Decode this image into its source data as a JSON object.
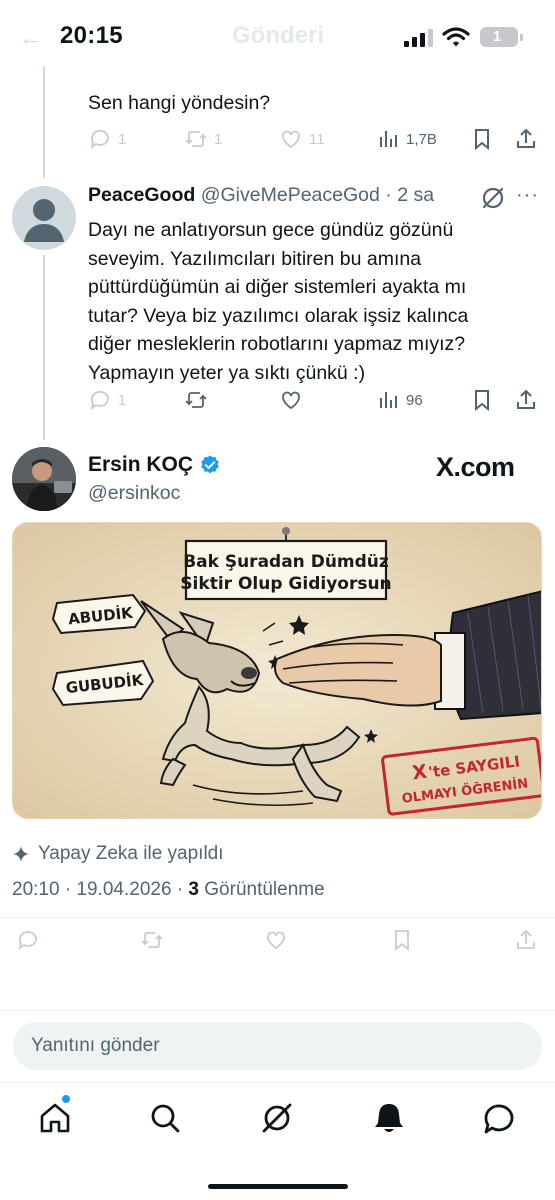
{
  "status_bar": {
    "time": "20:15",
    "back_faded": "←",
    "title_faded": "Gönderi",
    "battery": "1"
  },
  "parent_tweet": {
    "text": "Sen hangi yöndesin?",
    "stats": {
      "replies": "1",
      "retweets": "1",
      "likes": "11",
      "views": "1,7B"
    }
  },
  "reply_tweet": {
    "name": "PeaceGood",
    "handle": "@GiveMePeaceGod",
    "time": "· 2 sa",
    "text_lines": [
      "Dayı ne anlatıyorsun gece gündüz gözünü",
      "seveyim. Yazılımcıları bitiren bu amına",
      "püttürdüğümün ai diğer sistemleri ayakta mı",
      "tutar? Veya biz yazılımcı olarak işsiz kalınca",
      "diğer mesleklerin robotlarını yapmaz mıyız?",
      "Yapmayın yeter ya sıktı çünkü :)"
    ],
    "stats": {
      "replies": "1",
      "views": "96"
    },
    "more": "···"
  },
  "main_tweet": {
    "name": "Ersin KOÇ",
    "handle": "@ersinkoc",
    "brand_logo": "X.com",
    "image": {
      "sign_line1": "Bak Şuradan Dümdüz",
      "sign_line2": "Siktir Olup Gidiyorsun",
      "bubble_left1": "ABUDİK",
      "bubble_left2": "GUBUDİK",
      "stamp_line1_x": "X",
      "stamp_line1_rest": "'te SAYGILI",
      "stamp_line2": "OLMAYI ÖĞRENİN"
    },
    "ai_label": "Yapay Zeka ile yapıldı",
    "time": "20:10 · 19.04.2026 · ",
    "views_count": "3",
    "views_label": "Görüntülenme"
  },
  "reply_input": {
    "placeholder": "Yanıtını gönder"
  },
  "tab_bar": {
    "items": [
      "home-icon",
      "search-icon",
      "grok-icon",
      "notifications-icon",
      "messages-icon"
    ]
  },
  "colors": {
    "accent": "#1d9bf0",
    "text": "#0f1419",
    "secondary": "#536471",
    "faded": "#c4cdd3"
  }
}
